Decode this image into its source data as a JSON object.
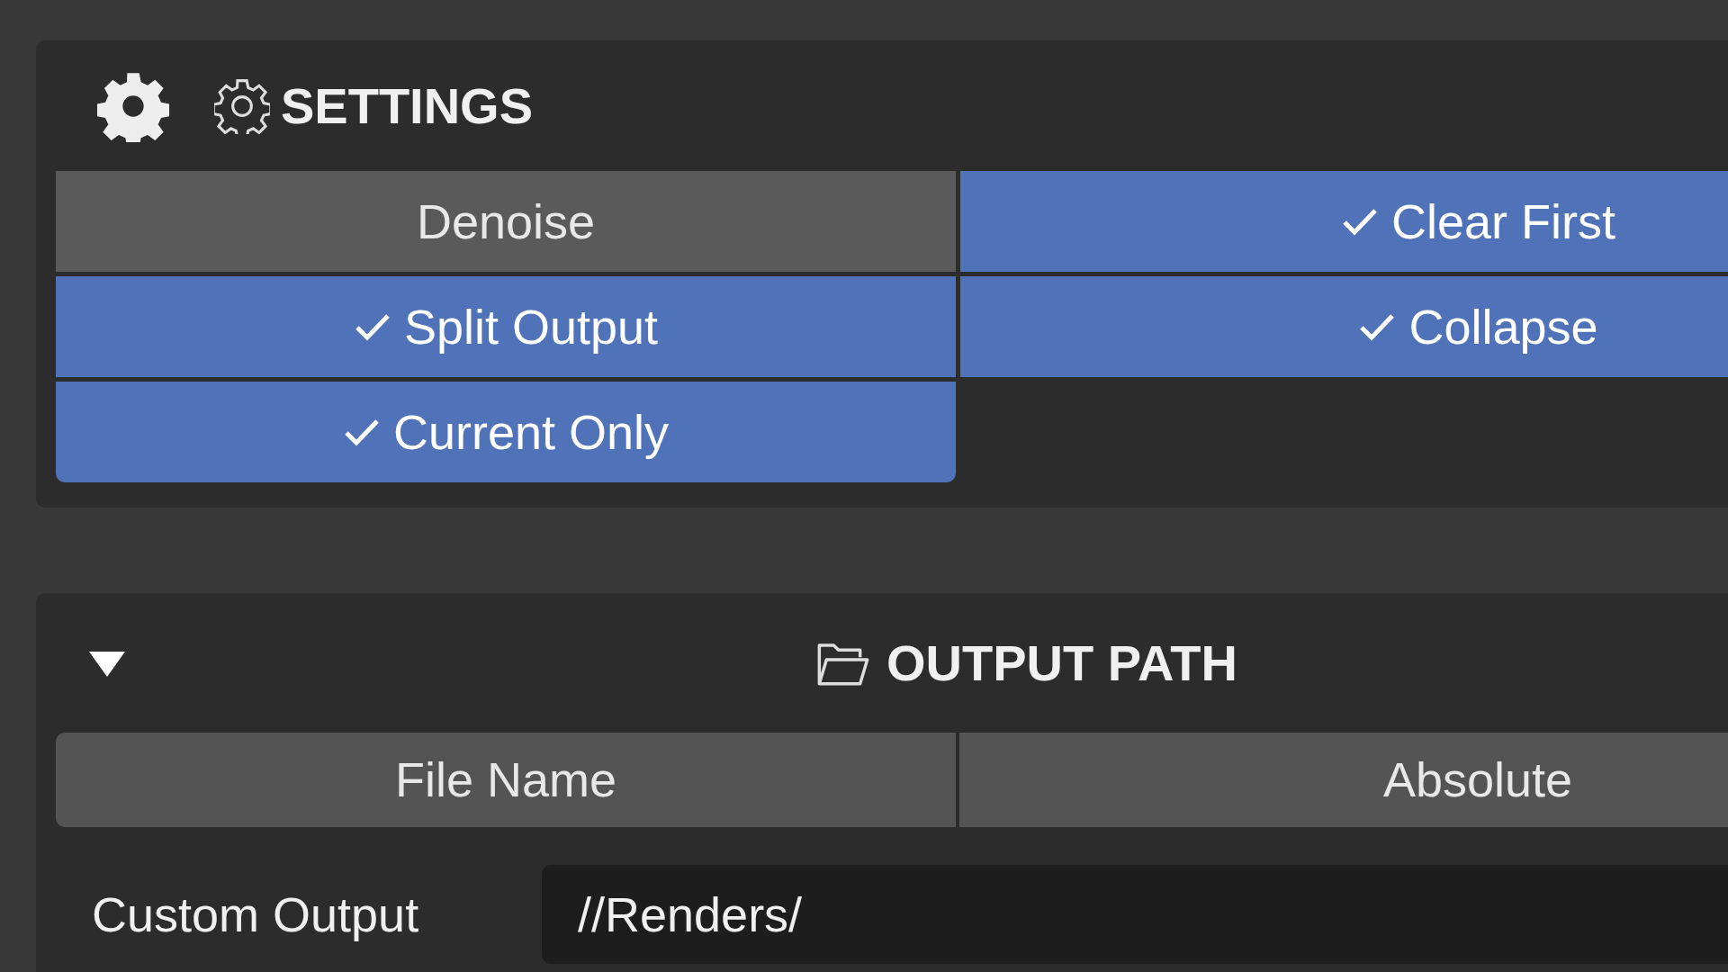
{
  "settings": {
    "title": "SETTINGS",
    "toggles": [
      {
        "label": "Denoise",
        "checked": false
      },
      {
        "label": "Clear First",
        "checked": true
      },
      {
        "label": "Split Output",
        "checked": true
      },
      {
        "label": "Collapse",
        "checked": true
      },
      {
        "label": "Current Only",
        "checked": true
      }
    ]
  },
  "output_path": {
    "title": "OUTPUT PATH",
    "expanded": true,
    "modes": [
      "File Name",
      "Absolute"
    ],
    "custom_output": {
      "label": "Custom Output",
      "value": "//Renders/"
    }
  }
}
